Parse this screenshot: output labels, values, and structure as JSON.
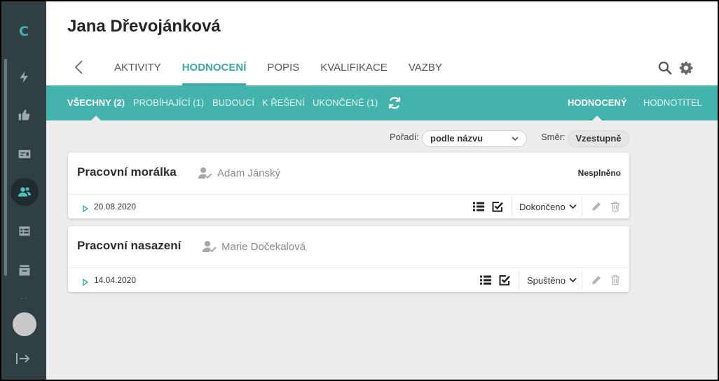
{
  "app": {
    "logo_letter": "C"
  },
  "header": {
    "person_name": "Jana Dřevojánková"
  },
  "tabs": [
    {
      "label": "AKTIVITY"
    },
    {
      "label": "HODNOCENÍ",
      "active": true
    },
    {
      "label": "POPIS"
    },
    {
      "label": "KVALIFIKACE"
    },
    {
      "label": "VAZBY"
    }
  ],
  "filters": [
    {
      "label": "VŠECHNY (2)",
      "active": true
    },
    {
      "label": "PROBÍHAJÍCÍ (1)"
    },
    {
      "label": "BUDOUCÍ"
    },
    {
      "label": "K ŘEŠENÍ"
    },
    {
      "label": "UKONČENÉ (1)"
    }
  ],
  "roles": [
    {
      "label": "HODNOCENÝ",
      "active": true
    },
    {
      "label": "HODNOTITEL"
    }
  ],
  "sort": {
    "order_label": "Pořadí:",
    "order_value": "podle názvu",
    "direction_label": "Směr:",
    "direction_value": "Vzestupně"
  },
  "sidebar": {
    "dots": "- -"
  },
  "evaluations": [
    {
      "title": "Pracovní morálka",
      "evaluator": "Adam Jánský",
      "result": "Nesplněno",
      "date": "20.08.2020",
      "state": "Dokončeno"
    },
    {
      "title": "Pracovní nasazení",
      "evaluator": "Marie Dočekalová",
      "result": "",
      "date": "14.04.2020",
      "state": "Spuštěno"
    }
  ],
  "colors": {
    "accent": "#45b3ad",
    "accent_text": "#3aa9a2",
    "sidebar": "#2f3f44",
    "background": "#ededed"
  }
}
